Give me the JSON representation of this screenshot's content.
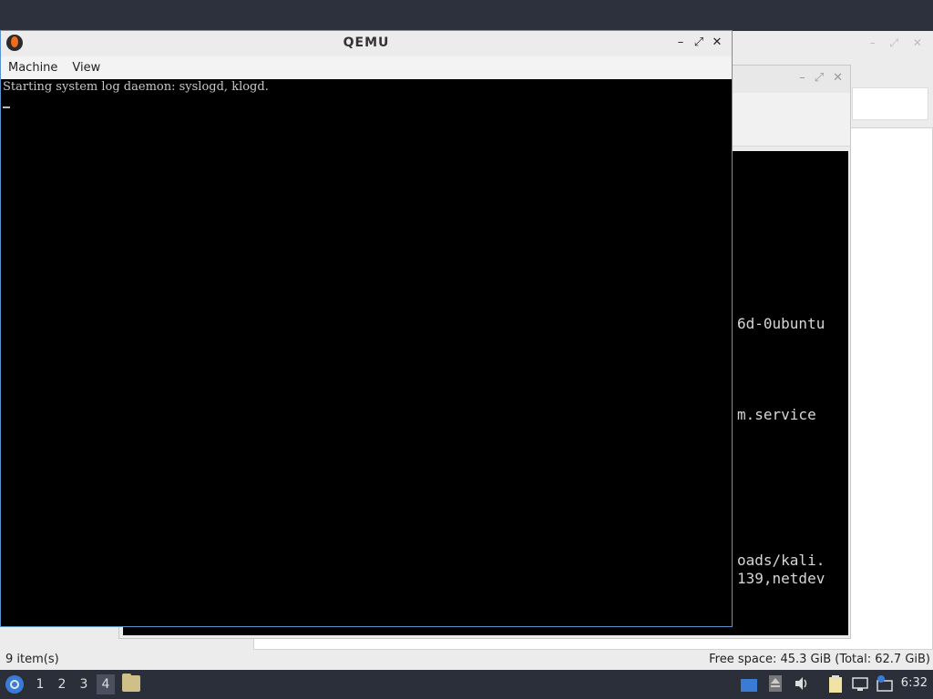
{
  "qemu": {
    "title": "QEMU",
    "menu": [
      "Machine",
      "View"
    ],
    "console_line": "Starting system log daemon: syslogd, klogd.",
    "controls": {
      "minimize": "–",
      "maximize": "⤢",
      "close": "✕"
    }
  },
  "terminal": {
    "lines": [
      "6d-0ubuntu",
      "m.service",
      "oads/kali.",
      "139,netdev"
    ]
  },
  "file_manager": {
    "status_left": "9 item(s)",
    "status_right": "Free space: 45.3 GiB (Total: 62.7 GiB)"
  },
  "taskbar": {
    "workspaces": [
      "1",
      "2",
      "3",
      "4"
    ],
    "active_workspace": "4",
    "clock": "6:32",
    "icons": [
      "start-menu-icon",
      "file-manager-icon",
      "desktop-icon",
      "eject-icon",
      "volume-icon",
      "clipboard-icon",
      "network-icon",
      "update-icon"
    ]
  },
  "colors": {
    "desktop": "#2f3340",
    "qemu_border": "#5a92d0",
    "taskbar": "#2b2f3a"
  }
}
